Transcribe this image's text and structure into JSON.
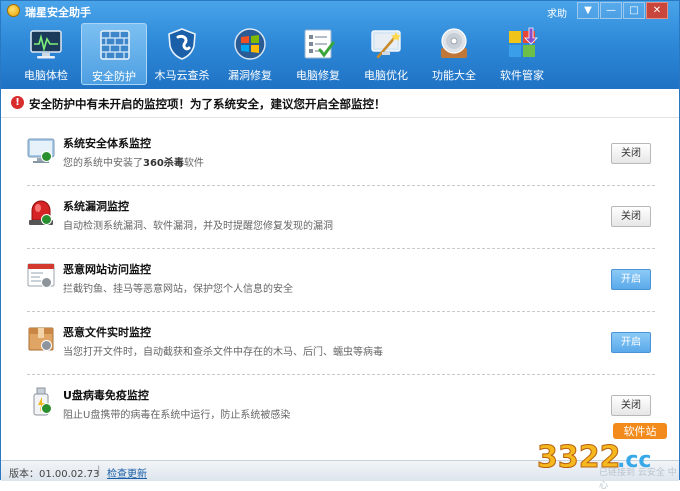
{
  "window": {
    "title": "瑞星安全助手",
    "help": "求助",
    "btn_menu": "▼",
    "btn_min": "—",
    "btn_max": "□",
    "btn_close": "✕"
  },
  "toolbar": [
    {
      "label": "电脑体检",
      "icon": "monitor-icon"
    },
    {
      "label": "安全防护",
      "icon": "firewall-icon",
      "active": true
    },
    {
      "label": "木马云查杀",
      "icon": "shield-icon"
    },
    {
      "label": "漏洞修复",
      "icon": "windows-icon"
    },
    {
      "label": "电脑修复",
      "icon": "checklist-icon"
    },
    {
      "label": "电脑优化",
      "icon": "wand-icon"
    },
    {
      "label": "功能大全",
      "icon": "disc-icon"
    },
    {
      "label": "软件管家",
      "icon": "software-icon"
    }
  ],
  "warning": "安全防护中有未开启的监控项！为了系统安全，建议您开启全部监控！",
  "items": [
    {
      "title": "系统安全体系监控",
      "desc_pre": "您的系统中安装了",
      "desc_bold": "360杀毒",
      "desc_post": "软件",
      "button": "关闭",
      "state": "off"
    },
    {
      "title": "系统漏洞监控",
      "desc": "自动检测系统漏洞、软件漏洞，并及时提醒您修复发现的漏洞",
      "button": "关闭",
      "state": "off"
    },
    {
      "title": "恶意网站访问监控",
      "desc": "拦截钓鱼、挂马等恶意网站，保护您个人信息的安全",
      "button": "开启",
      "state": "on"
    },
    {
      "title": "恶意文件实时监控",
      "desc": "当您打开文件时，自动截获和查杀文件中存在的木马、后门、蠕虫等病毒",
      "button": "开启",
      "state": "on"
    },
    {
      "title": "U盘病毒免疫监控",
      "desc": "阻止U盘携带的病毒在系统中运行，防止系统被感染",
      "button": "关闭",
      "state": "off"
    }
  ],
  "statusbar": {
    "version": "版本：01.00.02.73",
    "separator": "|",
    "check_update": "检查更新",
    "partial": "已链接到 云安全 中心"
  },
  "watermark": {
    "number": "3322",
    "domain": ".cc",
    "tag": "软件站"
  },
  "colors": {
    "header": "#2f8ad9",
    "warning": "#d92c2c",
    "enable_button": "#5aa9ea",
    "status_green": "#2a8f2f"
  }
}
